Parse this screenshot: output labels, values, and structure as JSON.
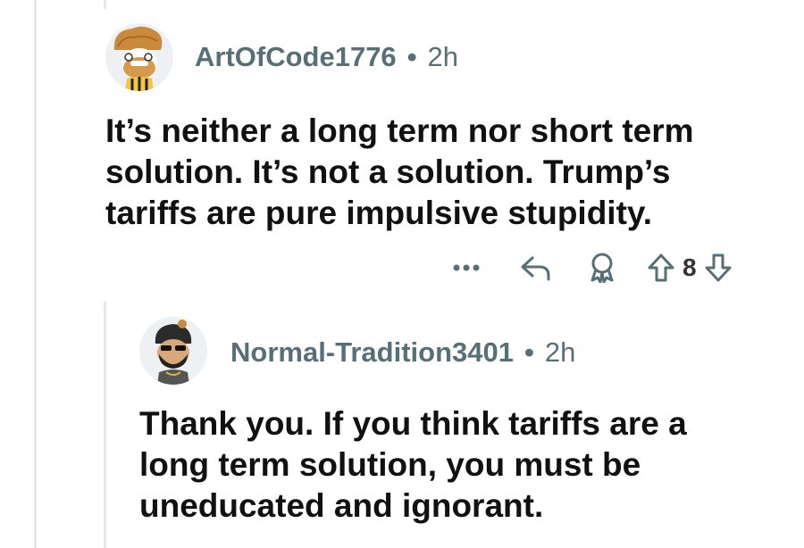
{
  "comments": [
    {
      "username": "ArtOfCode1776",
      "separator": "•",
      "time": "2h",
      "lines": [
        "It’s neither a long term nor short term",
        "solution.  It’s not a solution.  Trump’s",
        "tariffs are pure impulsive stupidity."
      ],
      "upvotes": "8"
    },
    {
      "username": "Normal-Tradition3401",
      "separator": "•",
      "time": "2h",
      "lines": [
        "Thank you. If you think tariffs are a",
        "long term solution, you must be",
        "uneducated and ignorant."
      ]
    }
  ],
  "icons": {
    "more": "more-options-icon",
    "reply": "reply-icon",
    "award": "award-icon",
    "upvote": "upvote-icon",
    "downvote": "downvote-icon"
  },
  "colors": {
    "meta_text": "#576f76",
    "body_text": "#111111",
    "thread_line": "#e5e7ea"
  }
}
